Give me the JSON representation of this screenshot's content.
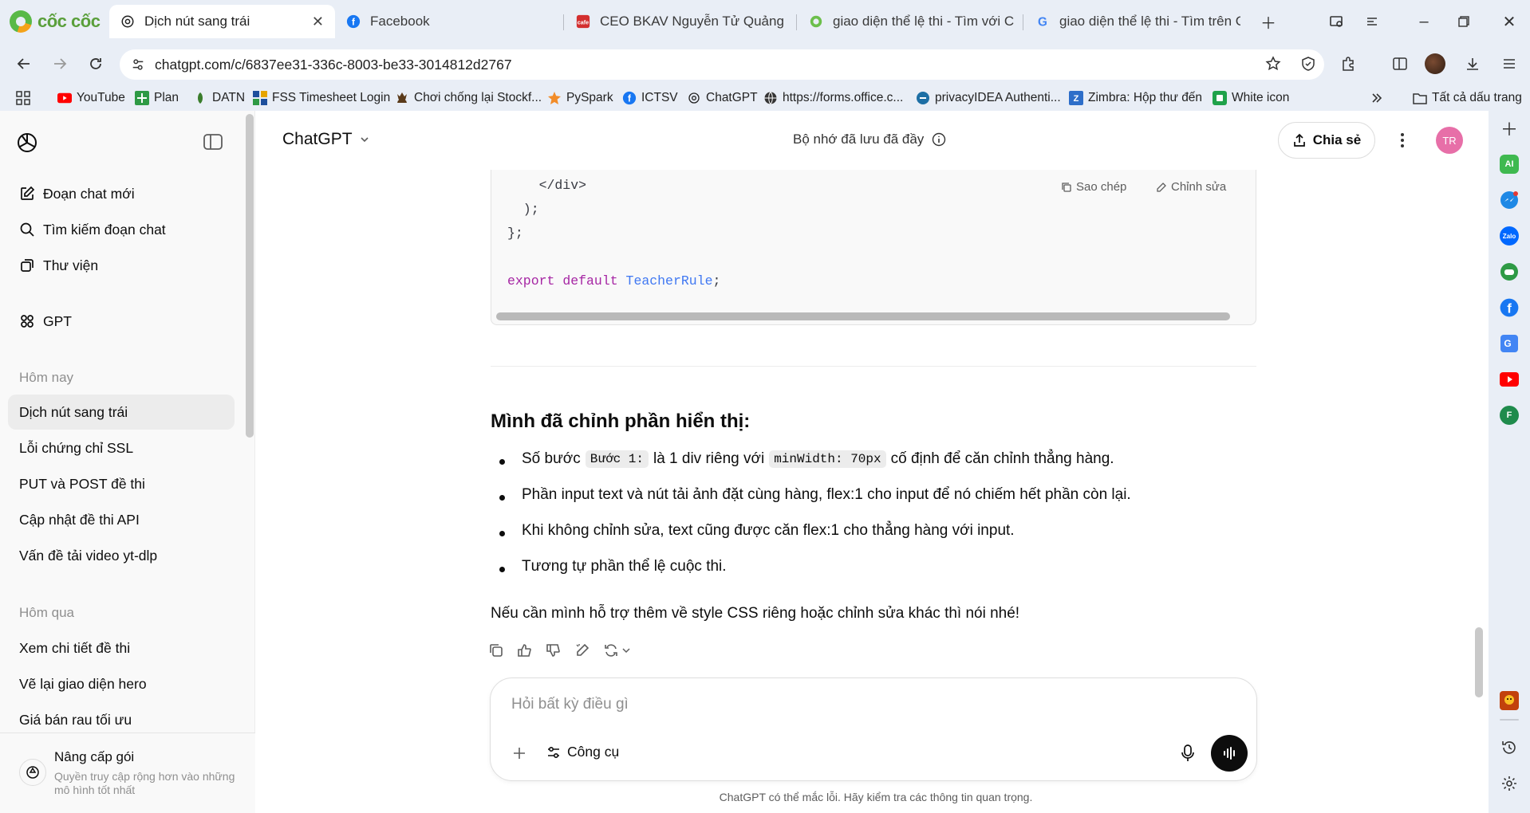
{
  "browser": {
    "brand": "cốc cốc",
    "tabs": [
      {
        "title": "Dịch nút sang trái",
        "active": true,
        "icon": "chatgpt-icon"
      },
      {
        "title": "Facebook",
        "active": false,
        "icon": "facebook-icon"
      },
      {
        "title": "CEO BKAV Nguyễn Tử Quảng: \"C",
        "active": false,
        "icon": "news-icon"
      },
      {
        "title": "giao diện thể lệ thi - Tìm với Cốc",
        "active": false,
        "icon": "coccoc-search-icon"
      },
      {
        "title": "giao diện thể lệ thi - Tìm trên Go",
        "active": false,
        "icon": "google-icon"
      }
    ],
    "url": "chatgpt.com/c/6837ee31-336c-8003-be33-3014812d2767",
    "bookmarks": [
      {
        "label": "YouTube",
        "icon": "youtube-icon"
      },
      {
        "label": "Plan",
        "icon": "plan-icon"
      },
      {
        "label": "DATN",
        "icon": "datn-icon"
      },
      {
        "label": "FSS Timesheet Login",
        "icon": "fss-icon"
      },
      {
        "label": "Chơi chống lại Stockf...",
        "icon": "chess-icon"
      },
      {
        "label": "PySpark",
        "icon": "pyspark-icon"
      },
      {
        "label": "ICTSV",
        "icon": "facebook-icon"
      },
      {
        "label": "ChatGPT",
        "icon": "chatgpt-icon"
      },
      {
        "label": "https://forms.office.c...",
        "icon": "globe-icon"
      },
      {
        "label": "privacyIDEA Authenti...",
        "icon": "privacyidea-icon"
      },
      {
        "label": "Zimbra: Hộp thư đến",
        "icon": "zimbra-icon"
      },
      {
        "label": "White icon",
        "icon": "white-icon-bookmark"
      }
    ],
    "all_bookmarks": "Tất cả dấu trang"
  },
  "sidebar": {
    "new_chat": "Đoạn chat mới",
    "search": "Tìm kiếm đoạn chat",
    "library": "Thư viện",
    "gpt": "GPT",
    "today_heading": "Hôm nay",
    "today": [
      "Dịch nút sang trái",
      "Lỗi chứng chỉ SSL",
      "PUT và POST đề thi",
      "Cập nhật đề thi API",
      "Vấn đề tải video yt-dlp"
    ],
    "yesterday_heading": "Hôm qua",
    "yesterday": [
      "Xem chi tiết đề thi",
      "Vẽ lại giao diện hero",
      "Giá bán rau tối ưu"
    ],
    "upgrade_title": "Nâng cấp gói",
    "upgrade_sub": "Quyền truy cập rộng hơn vào những mô hình tốt nhất"
  },
  "header": {
    "model": "ChatGPT",
    "memory": "Bộ nhớ đã lưu đã đầy",
    "share": "Chia sẻ",
    "avatar": "TR"
  },
  "code": {
    "copy": "Sao chép",
    "edit": "Chỉnh sửa",
    "line1": "    </div>",
    "line2": "  );",
    "line3": "};",
    "export_kw": "export",
    "default_kw": "default",
    "name": "TeacherRule",
    "semi": ";"
  },
  "message": {
    "heading": "Mình đã chỉnh phần hiển thị:",
    "b1_pre": "Số bước",
    "b1_code1": "Bước 1:",
    "b1_mid": "là 1 div riêng với",
    "b1_code2": "minWidth: 70px",
    "b1_post": "cố định để căn chỉnh thẳng hàng.",
    "b2": "Phần input text và nút tải ảnh đặt cùng hàng, flex:1 cho input để nó chiếm hết phần còn lại.",
    "b3": "Khi không chỉnh sửa, text cũng được căn flex:1 cho thẳng hàng với input.",
    "b4": "Tương tự phần thể lệ cuộc thi.",
    "closing": "Nếu cần mình hỗ trợ thêm về style CSS riêng hoặc chỉnh sửa khác thì nói nhé!"
  },
  "composer": {
    "placeholder": "Hỏi bất kỳ điều gì",
    "tools": "Công cụ"
  },
  "disclaimer": "ChatGPT có thể mắc lỗi. Hãy kiểm tra các thông tin quan trọng.",
  "rail": {
    "ai_label": "AI",
    "zalo_label": "Zalo",
    "f_label": "F"
  }
}
